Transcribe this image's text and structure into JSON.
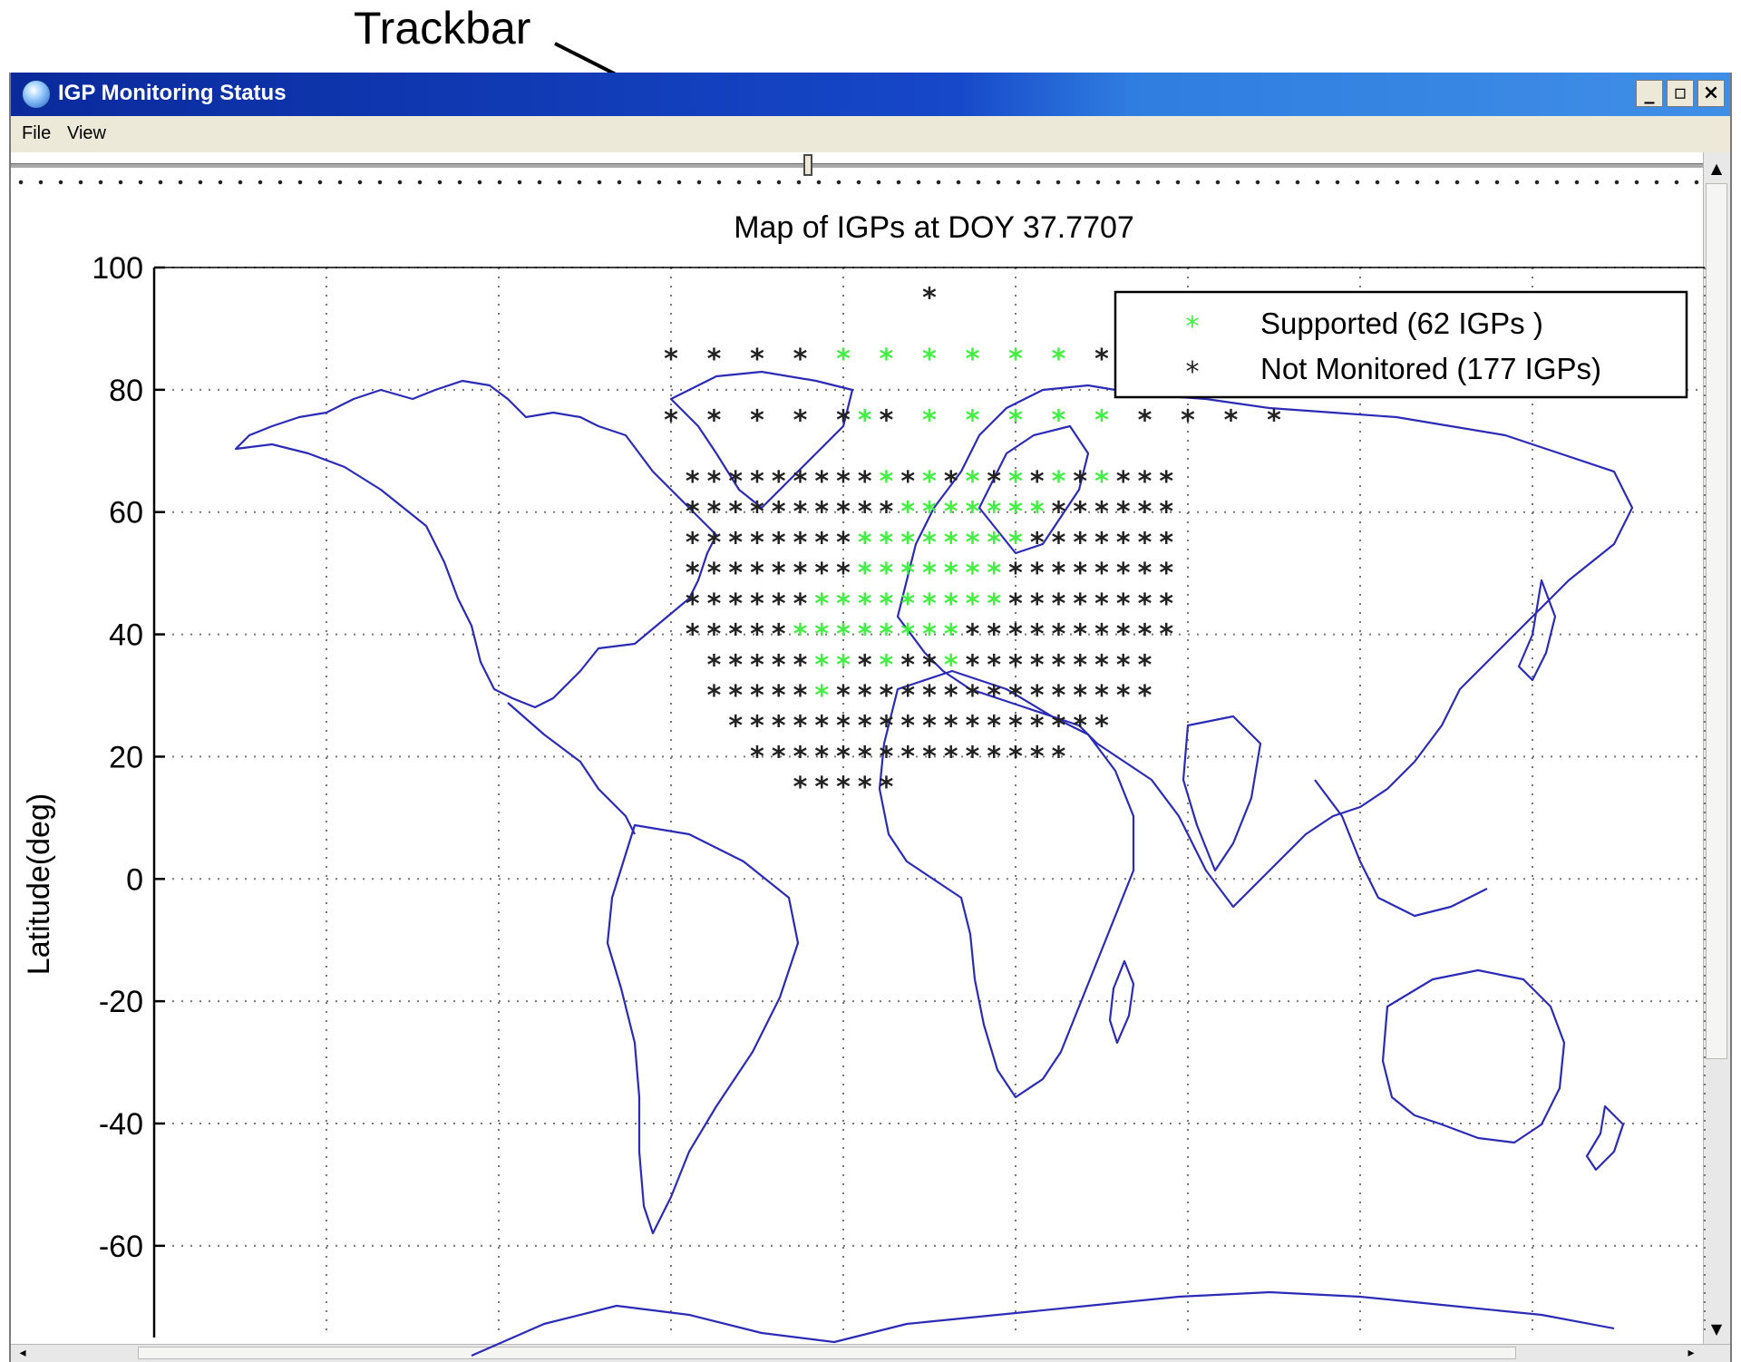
{
  "annotation": {
    "label": "Trackbar"
  },
  "window": {
    "title": "IGP Monitoring Status",
    "controls": {
      "minimize": "_",
      "restore": "▫",
      "close": "×"
    }
  },
  "menu": {
    "items": [
      "File",
      "View"
    ]
  },
  "trackbar": {
    "position": 0.47
  },
  "colors": {
    "supported": "#44ee44",
    "not_monitored": "#222222",
    "coastline": "#2b2bb5",
    "titlebar": "#1648c9"
  },
  "chart_data": {
    "type": "scatter",
    "title": "Map of IGPs at DOY 37.7707",
    "xlabel": "",
    "ylabel": "Latitude(deg)",
    "xlim": [
      -180,
      180
    ],
    "ylim": [
      -75,
      100
    ],
    "yticks": [
      100,
      80,
      60,
      40,
      20,
      0,
      -20,
      -40,
      -60
    ],
    "xgrid": [
      -180,
      -140,
      -100,
      -60,
      -20,
      20,
      60,
      100,
      140,
      180
    ],
    "grid": true,
    "legend_position": "top-right",
    "series": [
      {
        "name": "Supported (62 IGPs )",
        "marker": "star",
        "color": "#44ee44",
        "points": [
          [
            -20,
            85
          ],
          [
            -10,
            85
          ],
          [
            0,
            85
          ],
          [
            10,
            85
          ],
          [
            20,
            85
          ],
          [
            30,
            85
          ],
          [
            -15,
            75
          ],
          [
            0,
            75
          ],
          [
            10,
            75
          ],
          [
            20,
            75
          ],
          [
            30,
            75
          ],
          [
            40,
            75
          ],
          [
            -10,
            65
          ],
          [
            0,
            65
          ],
          [
            10,
            65
          ],
          [
            20,
            65
          ],
          [
            30,
            65
          ],
          [
            40,
            65
          ],
          [
            -5,
            60
          ],
          [
            0,
            60
          ],
          [
            5,
            60
          ],
          [
            10,
            60
          ],
          [
            15,
            60
          ],
          [
            20,
            60
          ],
          [
            25,
            60
          ],
          [
            -15,
            55
          ],
          [
            -10,
            55
          ],
          [
            -5,
            55
          ],
          [
            0,
            55
          ],
          [
            5,
            55
          ],
          [
            10,
            55
          ],
          [
            15,
            55
          ],
          [
            20,
            55
          ],
          [
            -15,
            50
          ],
          [
            -10,
            50
          ],
          [
            -5,
            50
          ],
          [
            0,
            50
          ],
          [
            5,
            50
          ],
          [
            10,
            50
          ],
          [
            15,
            50
          ],
          [
            -25,
            45
          ],
          [
            -20,
            45
          ],
          [
            -15,
            45
          ],
          [
            -10,
            45
          ],
          [
            -5,
            45
          ],
          [
            0,
            45
          ],
          [
            5,
            45
          ],
          [
            10,
            45
          ],
          [
            15,
            45
          ],
          [
            -30,
            40
          ],
          [
            -25,
            40
          ],
          [
            -20,
            40
          ],
          [
            -15,
            40
          ],
          [
            -10,
            40
          ],
          [
            -5,
            40
          ],
          [
            0,
            40
          ],
          [
            5,
            40
          ],
          [
            -25,
            35
          ],
          [
            -20,
            35
          ],
          [
            -10,
            35
          ],
          [
            5,
            35
          ],
          [
            -25,
            30
          ]
        ]
      },
      {
        "name": "Not Monitored (177 IGPs)",
        "marker": "star",
        "color": "#222222",
        "points": [
          [
            0,
            95
          ],
          [
            -60,
            85
          ],
          [
            -50,
            85
          ],
          [
            -40,
            85
          ],
          [
            -30,
            85
          ],
          [
            40,
            85
          ],
          [
            50,
            85
          ],
          [
            60,
            85
          ],
          [
            70,
            85
          ],
          [
            -60,
            75
          ],
          [
            -50,
            75
          ],
          [
            -40,
            75
          ],
          [
            -30,
            75
          ],
          [
            -20,
            75
          ],
          [
            -10,
            75
          ],
          [
            50,
            75
          ],
          [
            60,
            75
          ],
          [
            70,
            75
          ],
          [
            80,
            75
          ],
          [
            -55,
            65
          ],
          [
            -50,
            65
          ],
          [
            -45,
            65
          ],
          [
            -40,
            65
          ],
          [
            -35,
            65
          ],
          [
            -30,
            65
          ],
          [
            -25,
            65
          ],
          [
            -20,
            65
          ],
          [
            -15,
            65
          ],
          [
            -5,
            65
          ],
          [
            5,
            65
          ],
          [
            15,
            65
          ],
          [
            25,
            65
          ],
          [
            35,
            65
          ],
          [
            45,
            65
          ],
          [
            50,
            65
          ],
          [
            55,
            65
          ],
          [
            -55,
            60
          ],
          [
            -50,
            60
          ],
          [
            -45,
            60
          ],
          [
            -40,
            60
          ],
          [
            -35,
            60
          ],
          [
            -30,
            60
          ],
          [
            -25,
            60
          ],
          [
            -20,
            60
          ],
          [
            -15,
            60
          ],
          [
            -10,
            60
          ],
          [
            30,
            60
          ],
          [
            35,
            60
          ],
          [
            40,
            60
          ],
          [
            45,
            60
          ],
          [
            50,
            60
          ],
          [
            55,
            60
          ],
          [
            -55,
            55
          ],
          [
            -50,
            55
          ],
          [
            -45,
            55
          ],
          [
            -40,
            55
          ],
          [
            -35,
            55
          ],
          [
            -30,
            55
          ],
          [
            -25,
            55
          ],
          [
            -20,
            55
          ],
          [
            25,
            55
          ],
          [
            30,
            55
          ],
          [
            35,
            55
          ],
          [
            40,
            55
          ],
          [
            45,
            55
          ],
          [
            50,
            55
          ],
          [
            55,
            55
          ],
          [
            -55,
            50
          ],
          [
            -50,
            50
          ],
          [
            -45,
            50
          ],
          [
            -40,
            50
          ],
          [
            -35,
            50
          ],
          [
            -30,
            50
          ],
          [
            -25,
            50
          ],
          [
            -20,
            50
          ],
          [
            20,
            50
          ],
          [
            25,
            50
          ],
          [
            30,
            50
          ],
          [
            35,
            50
          ],
          [
            40,
            50
          ],
          [
            45,
            50
          ],
          [
            50,
            50
          ],
          [
            55,
            50
          ],
          [
            -55,
            45
          ],
          [
            -50,
            45
          ],
          [
            -45,
            45
          ],
          [
            -40,
            45
          ],
          [
            -35,
            45
          ],
          [
            -30,
            45
          ],
          [
            20,
            45
          ],
          [
            25,
            45
          ],
          [
            30,
            45
          ],
          [
            35,
            45
          ],
          [
            40,
            45
          ],
          [
            45,
            45
          ],
          [
            50,
            45
          ],
          [
            55,
            45
          ],
          [
            -55,
            40
          ],
          [
            -50,
            40
          ],
          [
            -45,
            40
          ],
          [
            -40,
            40
          ],
          [
            -35,
            40
          ],
          [
            10,
            40
          ],
          [
            15,
            40
          ],
          [
            20,
            40
          ],
          [
            25,
            40
          ],
          [
            30,
            40
          ],
          [
            35,
            40
          ],
          [
            40,
            40
          ],
          [
            45,
            40
          ],
          [
            50,
            40
          ],
          [
            55,
            40
          ],
          [
            -50,
            35
          ],
          [
            -45,
            35
          ],
          [
            -40,
            35
          ],
          [
            -35,
            35
          ],
          [
            -30,
            35
          ],
          [
            -15,
            35
          ],
          [
            -5,
            35
          ],
          [
            0,
            35
          ],
          [
            10,
            35
          ],
          [
            15,
            35
          ],
          [
            20,
            35
          ],
          [
            25,
            35
          ],
          [
            30,
            35
          ],
          [
            35,
            35
          ],
          [
            40,
            35
          ],
          [
            45,
            35
          ],
          [
            50,
            35
          ],
          [
            -50,
            30
          ],
          [
            -45,
            30
          ],
          [
            -40,
            30
          ],
          [
            -35,
            30
          ],
          [
            -30,
            30
          ],
          [
            -20,
            30
          ],
          [
            -15,
            30
          ],
          [
            -10,
            30
          ],
          [
            -5,
            30
          ],
          [
            0,
            30
          ],
          [
            5,
            30
          ],
          [
            10,
            30
          ],
          [
            15,
            30
          ],
          [
            20,
            30
          ],
          [
            25,
            30
          ],
          [
            30,
            30
          ],
          [
            35,
            30
          ],
          [
            40,
            30
          ],
          [
            45,
            30
          ],
          [
            50,
            30
          ],
          [
            -45,
            25
          ],
          [
            -40,
            25
          ],
          [
            -35,
            25
          ],
          [
            -30,
            25
          ],
          [
            -25,
            25
          ],
          [
            -20,
            25
          ],
          [
            -15,
            25
          ],
          [
            -10,
            25
          ],
          [
            -5,
            25
          ],
          [
            0,
            25
          ],
          [
            5,
            25
          ],
          [
            10,
            25
          ],
          [
            15,
            25
          ],
          [
            20,
            25
          ],
          [
            25,
            25
          ],
          [
            30,
            25
          ],
          [
            35,
            25
          ],
          [
            40,
            25
          ],
          [
            -40,
            20
          ],
          [
            -35,
            20
          ],
          [
            -30,
            20
          ],
          [
            -25,
            20
          ],
          [
            -20,
            20
          ],
          [
            -15,
            20
          ],
          [
            -10,
            20
          ],
          [
            -5,
            20
          ],
          [
            0,
            20
          ],
          [
            5,
            20
          ],
          [
            10,
            20
          ],
          [
            15,
            20
          ],
          [
            20,
            20
          ],
          [
            25,
            20
          ],
          [
            30,
            20
          ],
          [
            -30,
            15
          ],
          [
            -25,
            15
          ],
          [
            -20,
            15
          ],
          [
            -15,
            15
          ],
          [
            -10,
            15
          ]
        ]
      }
    ]
  }
}
